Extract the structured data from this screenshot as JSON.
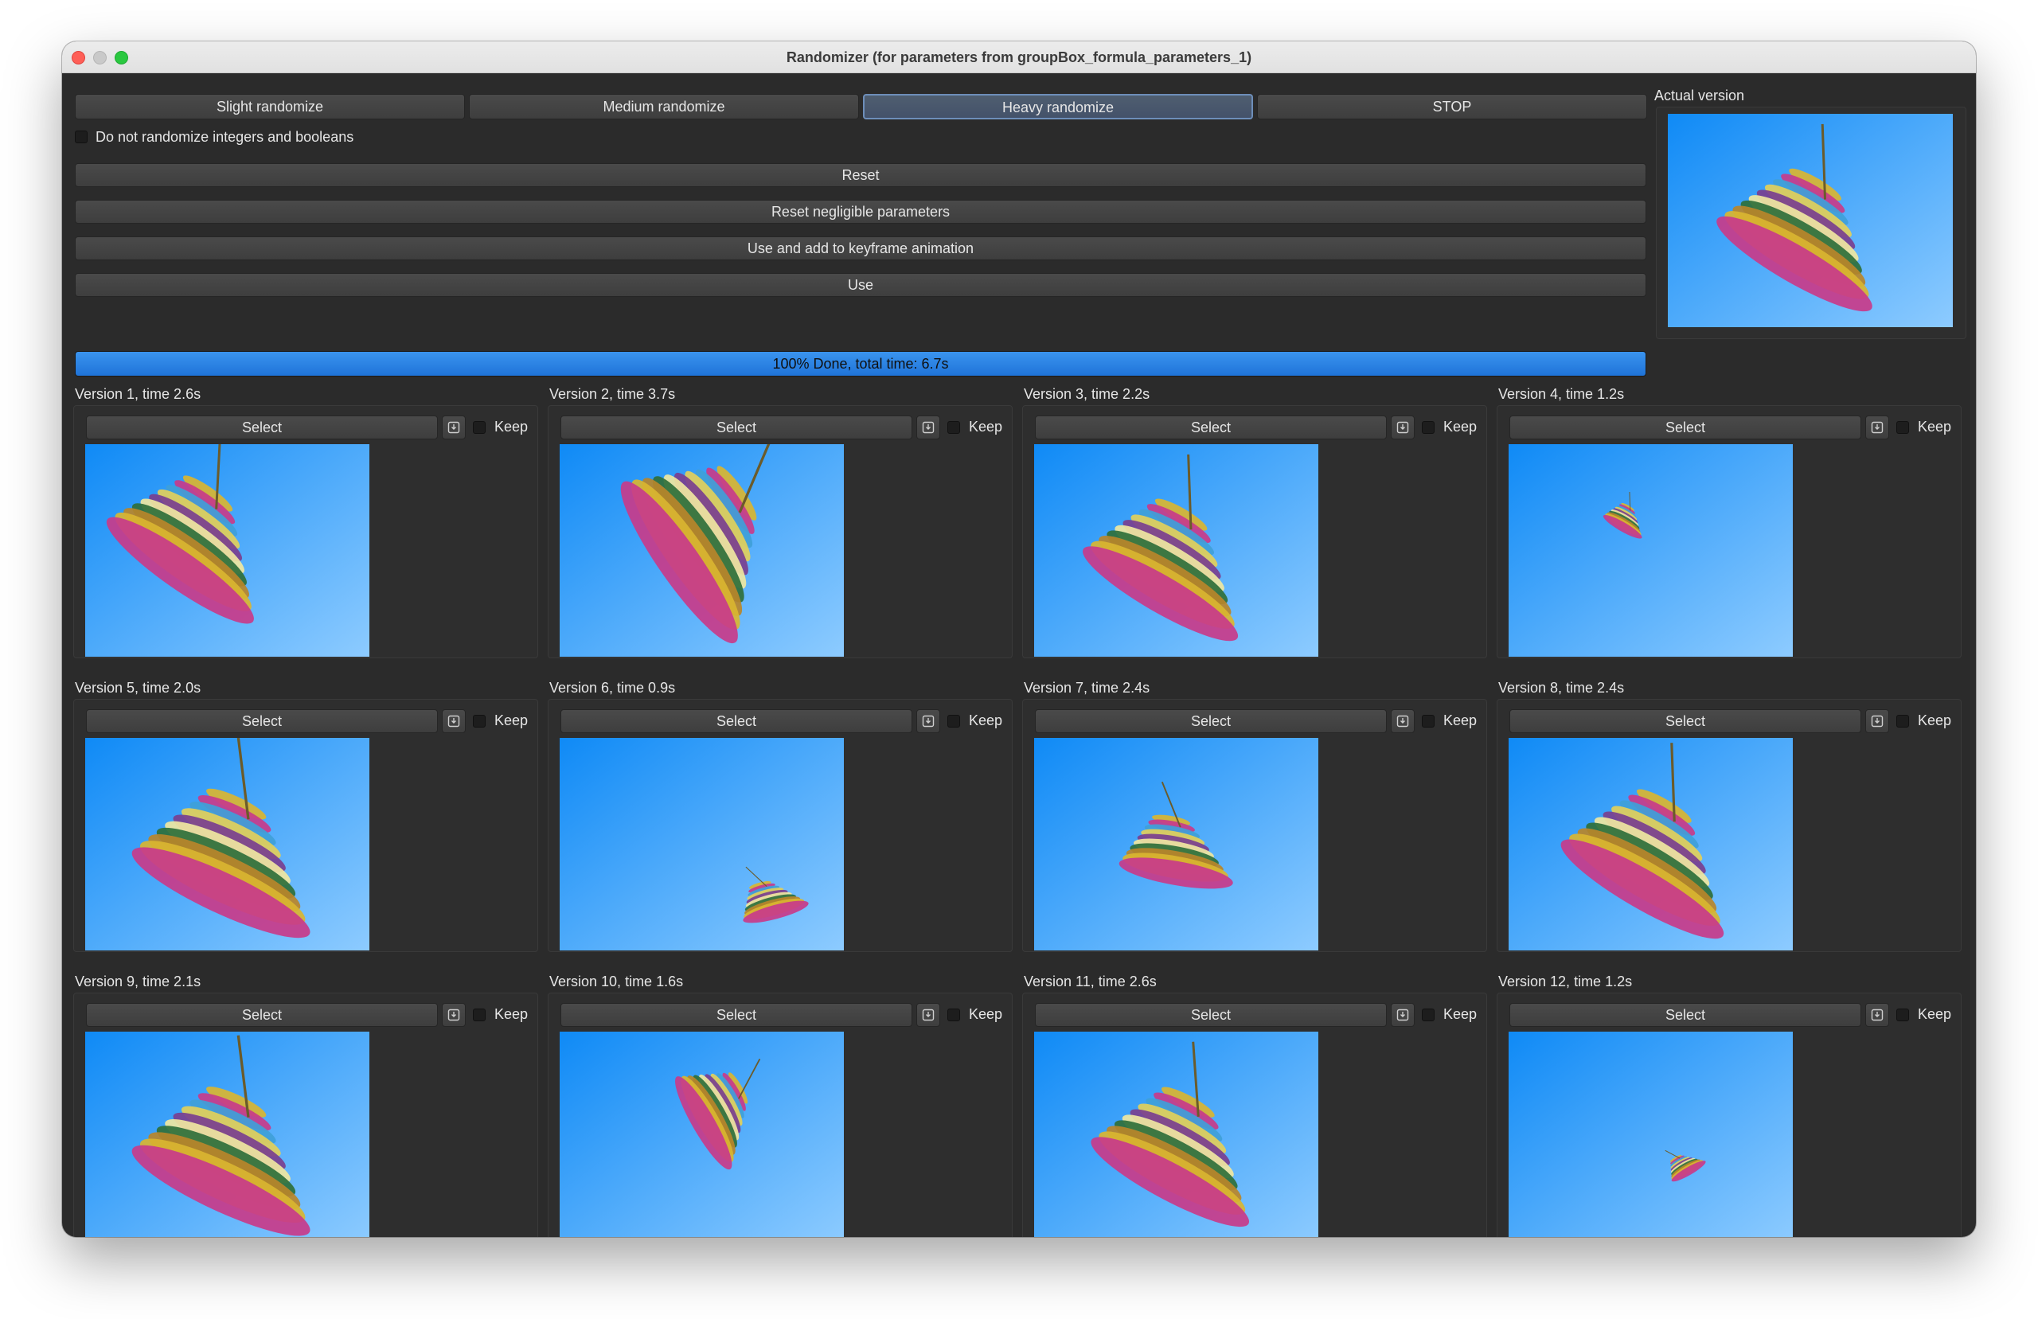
{
  "window": {
    "title": "Randomizer (for parameters from groupBox_formula_parameters_1)"
  },
  "toolbar": {
    "slight": "Slight randomize",
    "medium": "Medium randomize",
    "heavy": "Heavy randomize",
    "stop": "STOP"
  },
  "options": {
    "no_int_bool_label": "Do not randomize integers and booleans",
    "no_int_bool_checked": false
  },
  "actions": {
    "reset": "Reset",
    "reset_negligible": "Reset negligible parameters",
    "use_add_keyframe": "Use and add to keyframe animation",
    "use": "Use"
  },
  "progress": {
    "text": "100% Done, total time: 6.7s",
    "fraction": 1.0
  },
  "actual": {
    "label": "Actual version",
    "preview_icon": "fractal-preview"
  },
  "versions": [
    {
      "label": "Version 1, time 2.6s",
      "select": "Select",
      "keep": "Keep",
      "save_icon": "save-icon"
    },
    {
      "label": "Version 2, time 3.7s",
      "select": "Select",
      "keep": "Keep",
      "save_icon": "save-icon"
    },
    {
      "label": "Version 3, time 2.2s",
      "select": "Select",
      "keep": "Keep",
      "save_icon": "save-icon"
    },
    {
      "label": "Version 4, time 1.2s",
      "select": "Select",
      "keep": "Keep",
      "save_icon": "save-icon"
    },
    {
      "label": "Version 5, time 2.0s",
      "select": "Select",
      "keep": "Keep",
      "save_icon": "save-icon"
    },
    {
      "label": "Version 6, time 0.9s",
      "select": "Select",
      "keep": "Keep",
      "save_icon": "save-icon"
    },
    {
      "label": "Version 7, time 2.4s",
      "select": "Select",
      "keep": "Keep",
      "save_icon": "save-icon"
    },
    {
      "label": "Version 8, time 2.4s",
      "select": "Select",
      "keep": "Keep",
      "save_icon": "save-icon"
    },
    {
      "label": "Version 9, time 2.1s",
      "select": "Select",
      "keep": "Keep",
      "save_icon": "save-icon"
    },
    {
      "label": "Version 10, time 1.6s",
      "select": "Select",
      "keep": "Keep",
      "save_icon": "save-icon"
    },
    {
      "label": "Version 11, time 2.6s",
      "select": "Select",
      "keep": "Keep",
      "save_icon": "save-icon"
    },
    {
      "label": "Version 12, time 1.2s",
      "select": "Select",
      "keep": "Keep",
      "save_icon": "save-icon"
    }
  ],
  "colors": {
    "sky_top": "#0f8af6",
    "sky_bottom": "#8dcbff",
    "progress": "#2a86e8",
    "active_border": "#6d8eb9"
  }
}
